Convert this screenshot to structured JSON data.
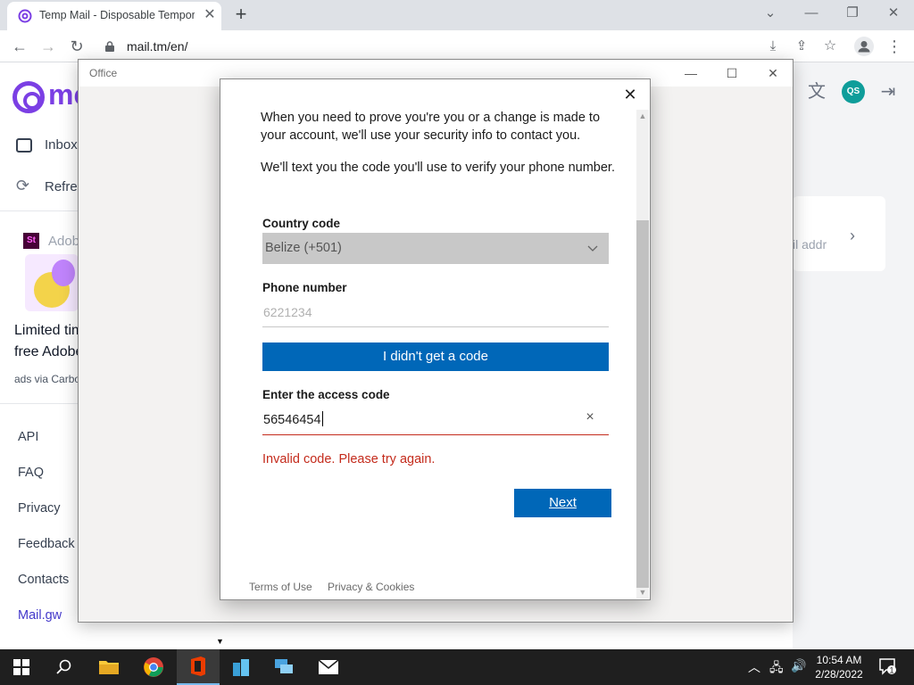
{
  "browser": {
    "tab_title": "Temp Mail - Disposable Temporary Email",
    "tab_close": "✕",
    "new_tab": "+",
    "url": "mail.tm/en/"
  },
  "page": {
    "brand_partial": "mc",
    "sidebar": [
      {
        "label": "Inbox",
        "icon": "inbox-icon"
      },
      {
        "label": "Refresh",
        "icon": "refresh-icon"
      }
    ],
    "ad": {
      "logo": "St",
      "name": "Adobe",
      "text_line1": "Limited time",
      "text_line2": "free Adobe",
      "via": "ads via Carbon"
    },
    "footer_links": [
      "API",
      "FAQ",
      "Privacy",
      "Feedback",
      "Contacts",
      "Mail.gw"
    ],
    "right_card_text": "il addr",
    "avatar_initials": "QS"
  },
  "office_window": {
    "title": "Office"
  },
  "dialog": {
    "intro": "When you need to prove you're you or a change is made to your account, we'll use your security info to contact you.",
    "instruction": "We'll text you the code you'll use to verify your phone number.",
    "country_label": "Country code",
    "country_value": "Belize (+501)",
    "phone_label": "Phone number",
    "phone_value": "6221234",
    "no_code_button": "I didn't get a code",
    "access_label": "Enter the access code",
    "access_value": "56546454",
    "error": "Invalid code. Please try again.",
    "next_button": "Next",
    "terms": "Terms of Use",
    "privacy": "Privacy & Cookies"
  },
  "taskbar": {
    "time": "10:54 AM",
    "date": "2/28/2022",
    "notification_count": "1"
  },
  "colors": {
    "primary_button": "#0067b8",
    "error": "#c42b1c",
    "brand": "#7b3fe4"
  }
}
